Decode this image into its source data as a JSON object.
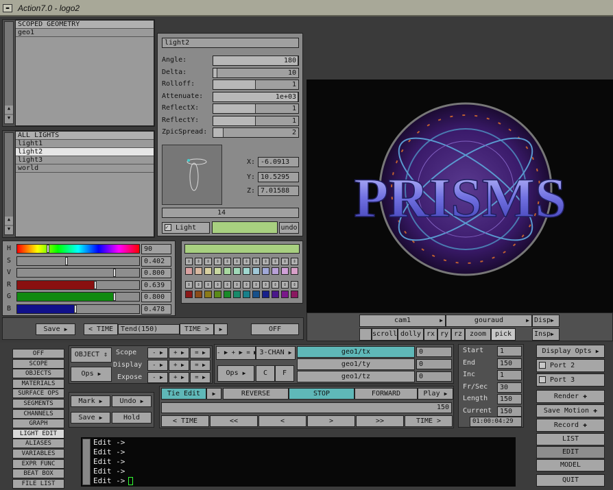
{
  "window": {
    "title": "Action7.0 - logo2"
  },
  "scope": {
    "header": "SCOPED GEOMETRY",
    "items": [
      "geo1"
    ]
  },
  "lights": {
    "header": "ALL LIGHTS",
    "items": [
      "light1",
      "light2",
      "light3",
      "world"
    ],
    "selected": "light2"
  },
  "light": {
    "name": "light2",
    "params": [
      {
        "label": "Angle:",
        "value": "180",
        "fill": 1.0
      },
      {
        "label": "Delta:",
        "value": "10",
        "fill": 0.05
      },
      {
        "label": "Rolloff:",
        "value": "1",
        "fill": 0.5
      },
      {
        "label": "Attenuate:",
        "value": "1e+03",
        "fill": 1.0
      },
      {
        "label": "ReflectX:",
        "value": "1",
        "fill": 0.5
      },
      {
        "label": "ReflectY:",
        "value": "1",
        "fill": 0.5
      },
      {
        "label": "ZpicSpread:",
        "value": "2",
        "fill": 0.12
      }
    ],
    "x_label": "X:",
    "x": "-6.0913",
    "y_label": "Y:",
    "y": "10.5295",
    "z_label": "Z:",
    "z": "7.01588",
    "slider_value": "14",
    "light_toggle": "Light",
    "undo": "undo",
    "light_color": "#a8d080"
  },
  "hsv": [
    {
      "label": "H",
      "value": "90"
    },
    {
      "label": "S",
      "value": "0.402"
    },
    {
      "label": "V",
      "value": "0.800"
    },
    {
      "label": "R",
      "value": "0.639"
    },
    {
      "label": "G",
      "value": "0.800"
    },
    {
      "label": "B",
      "value": "0.478"
    }
  ],
  "palette": {
    "row1": [
      "#d8a0a0",
      "#d8b8a0",
      "#d8d0a0",
      "#c8d8a0",
      "#a8d8a0",
      "#a0d8b8",
      "#a0d8d0",
      "#a0c8d8",
      "#a0a8d8",
      "#b8a0d8",
      "#d0a0d8",
      "#d8a0c8"
    ],
    "row2": [
      "#8a1818",
      "#8a4a18",
      "#8a7a18",
      "#5a8a18",
      "#188a28",
      "#188a6a",
      "#18808a",
      "#18508a",
      "#18208a",
      "#4a188a",
      "#7a188a",
      "#8a1860"
    ]
  },
  "timebar": {
    "save": "Save",
    "time_left": "< TIME",
    "tend": "Tend(150)",
    "time_right": "TIME >",
    "off": "OFF"
  },
  "viewport": {
    "logo_text": "PRISMS",
    "camera": "cam1",
    "shading": "gouraud",
    "disp": "Disp",
    "insp": "Insp",
    "tools": [
      "scroll",
      "dolly",
      "rx",
      "ry",
      "rz",
      "zoom",
      "pick"
    ]
  },
  "modes": [
    "OFF",
    "SCOPE",
    "OBJECTS",
    "MATERIALS",
    "SURFACE OPS",
    "SEGMENTS",
    "CHANNELS",
    "GRAPH",
    "LIGHT EDIT",
    "ALIASES",
    "VARIABLES",
    "EXPR FUNC",
    "BEAT BOX",
    "FILE LIST"
  ],
  "active_mode": "LIGHT EDIT",
  "object": {
    "object": "OBJECT",
    "ops": "Ops",
    "scope": "Scope",
    "display": "Display",
    "expose": "Expose"
  },
  "chan": {
    "label": "3-CHAN",
    "ops": "Ops",
    "c": "C",
    "f": "F",
    "channels": [
      {
        "name": "geo1/tx",
        "value": "0"
      },
      {
        "name": "geo1/ty",
        "value": "0"
      },
      {
        "name": "geo1/tz",
        "value": "0"
      }
    ]
  },
  "play": {
    "tie_edit": "Tie Edit",
    "reverse": "REVERSE",
    "stop": "STOP",
    "forward": "FORWARD",
    "play": "Play",
    "frame": "150",
    "nav": [
      "< TIME",
      "<<",
      "<",
      ">",
      ">>",
      "TIME >"
    ]
  },
  "edit": {
    "mark": "Mark",
    "undo": "Undo",
    "save": "Save",
    "hold": "Hold"
  },
  "frames": {
    "start_label": "Start",
    "start": "1",
    "end_label": "End",
    "end": "150",
    "inc_label": "Inc",
    "inc": "1",
    "fps_label": "Fr/Sec",
    "fps": "30",
    "length_label": "Length",
    "length": "150",
    "current_label": "Current",
    "current": "150",
    "timecode": "01:00:04:29"
  },
  "right": {
    "display_opts": "Display Opts",
    "port2": "Port 2",
    "port3": "Port 3",
    "render": "Render",
    "save_motion": "Save Motion",
    "record": "Record",
    "list": "LIST",
    "edit": "EDIT",
    "model": "MODEL",
    "quit": "QUIT"
  },
  "console": {
    "lines": [
      "Edit ->",
      "Edit ->",
      "Edit ->",
      "Edit ->",
      "Edit ->"
    ]
  }
}
